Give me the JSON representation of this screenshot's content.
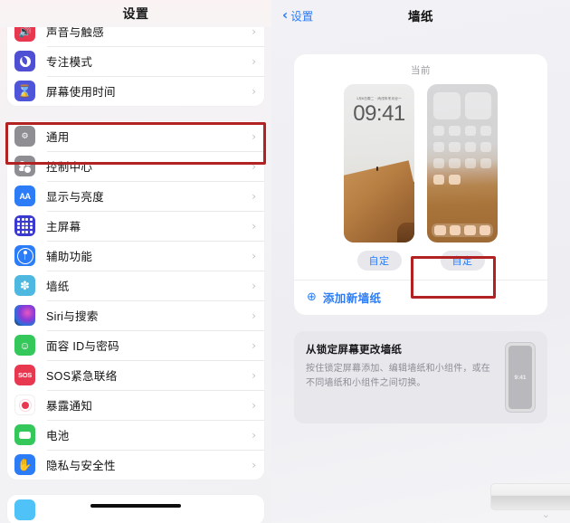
{
  "left": {
    "nav_title": "设置",
    "groups": [
      {
        "items": [
          {
            "label": "声音与触感",
            "icon": "sound-haptics-icon",
            "icon_bg": "#e8384f"
          },
          {
            "label": "专注模式",
            "icon": "focus-moon-icon",
            "icon_bg": "#4f4fd4"
          },
          {
            "label": "屏幕使用时间",
            "icon": "screen-time-hourglass-icon",
            "icon_bg": "#4f55d8"
          }
        ]
      },
      {
        "items": [
          {
            "label": "通用",
            "icon": "general-gear-icon",
            "icon_bg": "#8e8e93"
          },
          {
            "label": "控制中心",
            "icon": "control-center-icon",
            "icon_bg": "#8e8e93"
          },
          {
            "label": "显示与亮度",
            "icon": "display-brightness-aa-icon",
            "icon_bg": "#2b7cf6"
          },
          {
            "label": "主屏幕",
            "icon": "home-screen-grid-icon",
            "icon_bg": "#3a3ad0"
          },
          {
            "label": "辅助功能",
            "icon": "accessibility-icon",
            "icon_bg": "#2b7cf6"
          },
          {
            "label": "墙纸",
            "icon": "wallpaper-flower-icon",
            "icon_bg": "#4fb8e0"
          },
          {
            "label": "Siri与搜索",
            "icon": "siri-icon",
            "icon_bg": "#1c1c2e"
          },
          {
            "label": "面容 ID与密码",
            "icon": "face-id-icon",
            "icon_bg": "#34c759"
          },
          {
            "label": "SOS紧急联络",
            "icon": "sos-icon",
            "icon_bg": "#e8384f"
          },
          {
            "label": "暴露通知",
            "icon": "exposure-notification-icon",
            "icon_bg": "#ffffff"
          },
          {
            "label": "电池",
            "icon": "battery-icon",
            "icon_bg": "#34c759"
          },
          {
            "label": "隐私与安全性",
            "icon": "privacy-hand-icon",
            "icon_bg": "#2b7cf6"
          }
        ]
      }
    ],
    "chevron": "›"
  },
  "right": {
    "nav": {
      "back_label": "设置",
      "back_chevron": "‹",
      "title": "墙纸"
    },
    "wallpaper_card": {
      "current_label": "当前",
      "lock_preview": {
        "name": "lock-screen-preview",
        "date": "1月6日周二 · 丙戌年冬月廿一",
        "time": "09:41",
        "customize_label": "自定"
      },
      "home_preview": {
        "name": "home-screen-preview",
        "customize_label": "自定"
      },
      "add_new": {
        "icon": "⊕",
        "label": "添加新墙纸"
      }
    },
    "tip": {
      "title": "从锁定屏幕更改墙纸",
      "body": "按住锁定屏幕添加、编辑墙纸和小组件，或在不同墙纸和小组件之间切换。",
      "phone_time": "9:41"
    }
  },
  "annotations": {
    "highlight_color": "#b22222",
    "boxes": [
      {
        "name": "general-row-highlight",
        "target": "通用"
      },
      {
        "name": "home-customize-highlight",
        "target": "自定"
      }
    ]
  }
}
